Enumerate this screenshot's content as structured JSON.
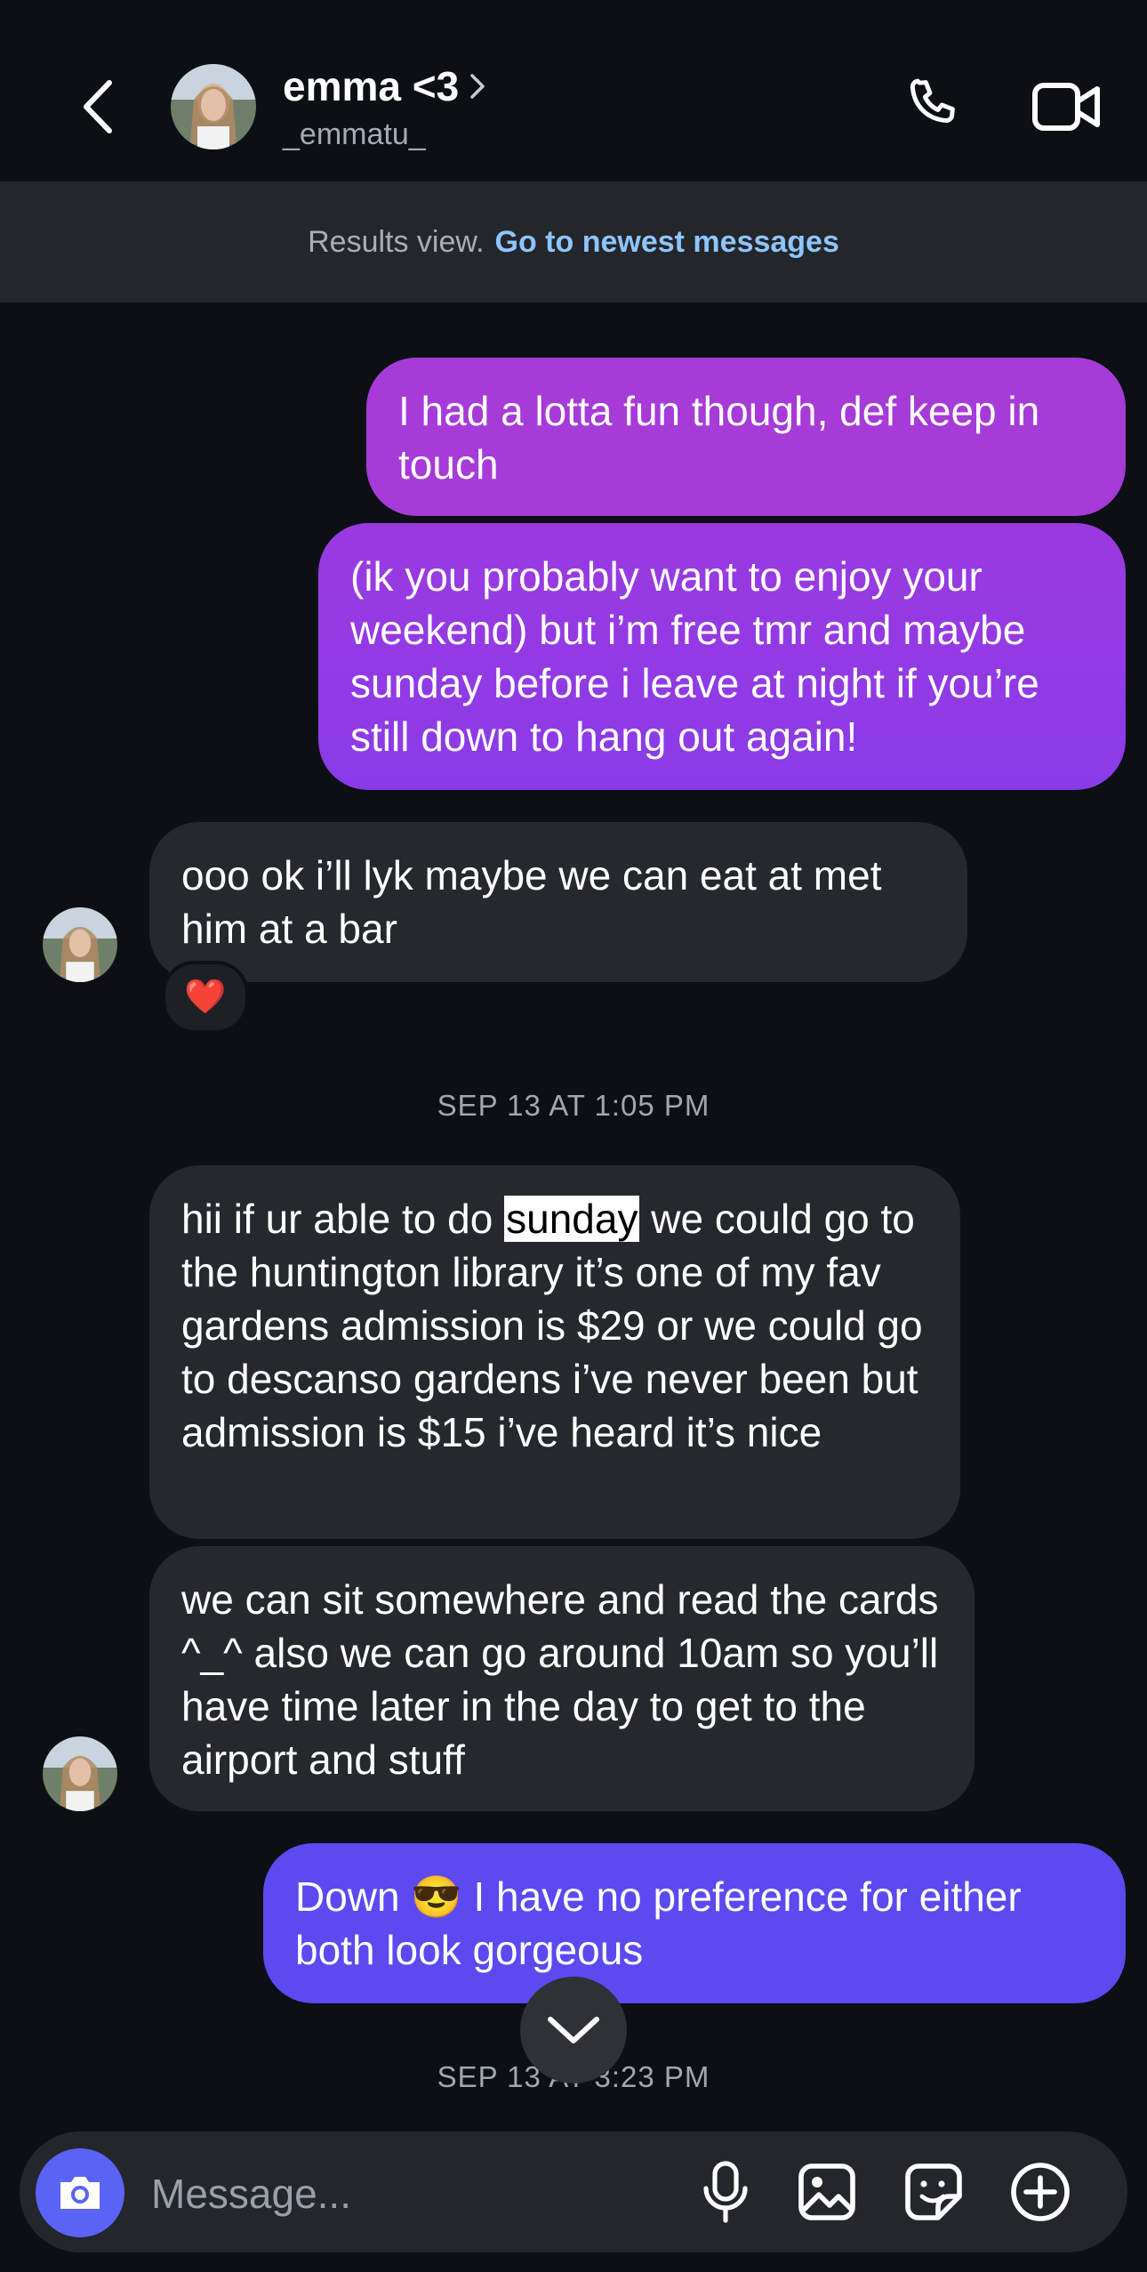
{
  "header": {
    "name": "emma <3",
    "handle": "_emmatu_"
  },
  "banner": {
    "text": "Results view.",
    "link": "Go to newest messages"
  },
  "messages": {
    "m1": "I had a lotta fun though, def keep in touch",
    "m2": "(ik you probably want to enjoy your weekend) but i’m free tmr and maybe sunday before i leave at night if you’re still down to hang out again!",
    "m3": "ooo ok i’ll lyk maybe we can eat at met him at a bar",
    "m3_reaction": "❤️",
    "ts1": "SEP 13 AT 1:05 PM",
    "m4_pre": "hii if ur able to do ",
    "m4_hl": "sunday",
    "m4_post": " we could go to the huntington library it’s one of my fav gardens admission is $29 or we could go to descanso gardens i’ve never been but admission is $15 i’ve heard it’s nice",
    "m5": "we can sit somewhere and read the cards ^_^ also we can go around 10am so you’ll have time later in the day to get to the airport and stuff",
    "m6_pre": "Down ",
    "m6_emoji": "😎",
    "m6_post": " I have no preference for either both look gorgeous",
    "ts2": "SEP 13 AT 3:23 PM"
  },
  "composer": {
    "placeholder": "Message..."
  },
  "colors": {
    "background": "#0c0f14",
    "incoming": "#25282d",
    "outgoing_top": "#a13ed9",
    "outgoing_mid": "#8b3be6",
    "outgoing_bottom": "#5b4af0",
    "link": "#8ec5ff",
    "camera": "#5b63f5"
  },
  "icons": {
    "back": "chevron-left-icon",
    "call": "phone-icon",
    "video": "video-camera-icon",
    "camera": "camera-icon",
    "mic": "microphone-icon",
    "gallery": "image-icon",
    "sticker": "sticker-icon",
    "more": "plus-circle-icon",
    "scroll": "chevron-down-icon"
  }
}
